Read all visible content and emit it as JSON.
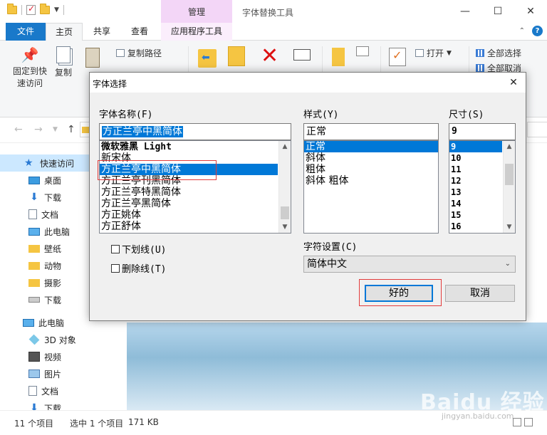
{
  "explorer": {
    "title": "字体替换工具",
    "manage_tab": "管理",
    "tabs": {
      "file": "文件",
      "home": "主页",
      "share": "共享",
      "view": "查看",
      "app_tools": "应用程序工具"
    },
    "ribbon": {
      "pin_line1": "固定到快",
      "pin_line2": "速访问",
      "copy": "复制",
      "copy_path": "复制路径",
      "open": "打开",
      "select_all": "全部选择",
      "select_none": "全部取消"
    },
    "nav_items": [
      {
        "label": "快速访问",
        "icon": "star-icon"
      },
      {
        "label": "桌面",
        "icon": "desktop-icon"
      },
      {
        "label": "下载",
        "icon": "download-icon"
      },
      {
        "label": "文档",
        "icon": "document-icon"
      },
      {
        "label": "此电脑",
        "icon": "computer-icon"
      },
      {
        "label": "壁纸",
        "icon": "folder-icon"
      },
      {
        "label": "动物",
        "icon": "folder-icon"
      },
      {
        "label": "摄影",
        "icon": "folder-icon"
      },
      {
        "label": "下载",
        "icon": "drive-icon"
      },
      {
        "label": "此电脑",
        "icon": "computer-icon"
      },
      {
        "label": "3D 对象",
        "icon": "3d-objects-icon"
      },
      {
        "label": "视频",
        "icon": "video-icon"
      },
      {
        "label": "图片",
        "icon": "pictures-icon"
      },
      {
        "label": "文档",
        "icon": "document-icon"
      },
      {
        "label": "下载",
        "icon": "download-icon"
      }
    ],
    "status": {
      "items": "11 个项目",
      "selected": "选中 1 个项目",
      "size": "171 KB"
    }
  },
  "dialog": {
    "title": "字体选择",
    "font_name_label": "字体名称(F)",
    "font_name_value": "方正兰亭中黑简体",
    "font_list": [
      "微软雅黑 Light",
      "新宋体",
      "方正兰亭中黑简体",
      "方正兰亭刊黑简体",
      "方正兰亭特黑简体",
      "方正兰亭黑简体",
      "方正姚体",
      "方正舒体"
    ],
    "style_label": "样式(Y)",
    "style_value": "正常",
    "style_list": [
      "正常",
      "斜体",
      "粗体",
      "斜体 粗体"
    ],
    "size_label": "尺寸(S)",
    "size_value": "9",
    "size_list": [
      "9",
      "10",
      "11",
      "12",
      "13",
      "14",
      "15",
      "16"
    ],
    "underline_label": "下划线(U)",
    "strikeout_label": "删除线(T)",
    "charset_label": "字符设置(C)",
    "charset_value": "简体中文",
    "ok_label": "好的",
    "cancel_label": "取消"
  },
  "watermark": {
    "main": "Baidu 经验",
    "sub": "jingyan.baidu.com"
  },
  "colors": {
    "selection": "#0078d7",
    "file_tab": "#1979ca",
    "manage_tab": "#f3d6f7",
    "highlight_box": "#e23b3b"
  }
}
